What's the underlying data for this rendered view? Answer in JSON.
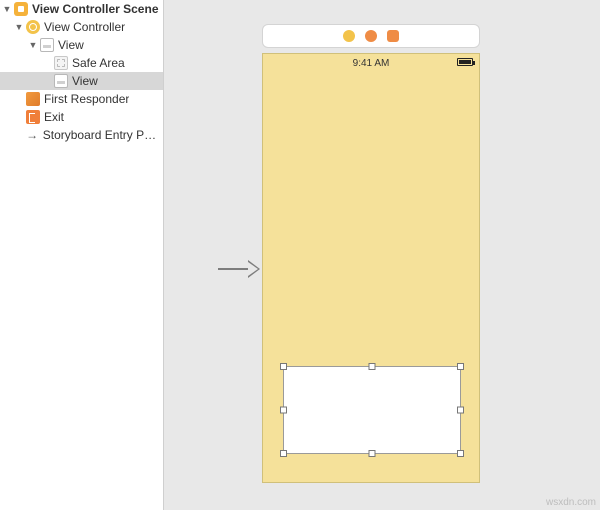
{
  "outline": {
    "scene_label": "View Controller Scene",
    "vc_label": "View Controller",
    "root_view_label": "View",
    "safe_area_label": "Safe Area",
    "child_view_label": "View",
    "first_responder_label": "First Responder",
    "exit_label": "Exit",
    "entry_point_label": "Storyboard Entry Poi…",
    "selected": "child_view"
  },
  "device": {
    "status_time": "9:41 AM",
    "bg_color": "#f5e19a"
  },
  "watermark": "wsxdn.com"
}
